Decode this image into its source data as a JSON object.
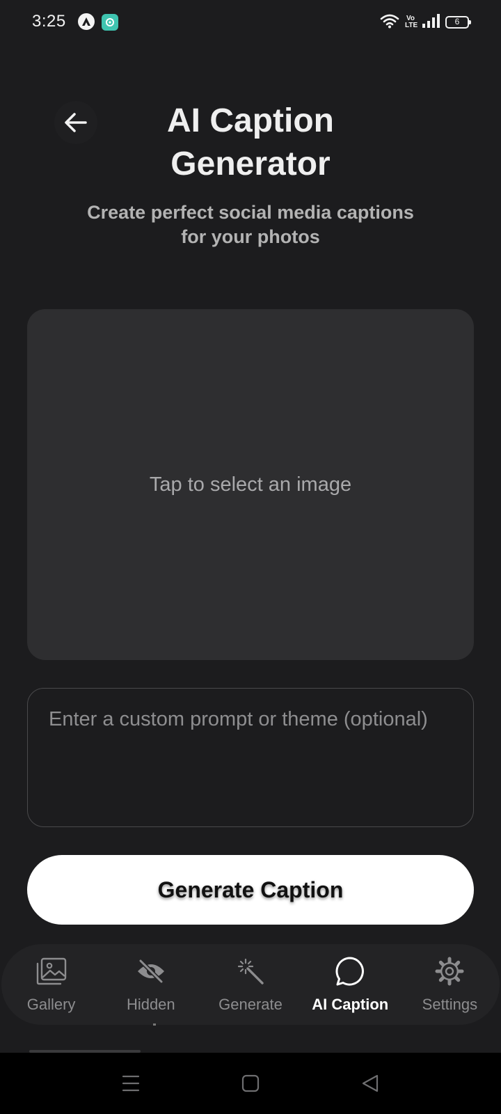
{
  "status_bar": {
    "time": "3:25",
    "volte_label": "Vo LTE",
    "battery_level": "6",
    "icons": [
      "app-a-icon",
      "app-teal-icon",
      "wifi-icon",
      "volte-icon",
      "signal-icon",
      "battery-icon"
    ]
  },
  "header": {
    "back_icon": "arrow-left-icon",
    "title": "AI Caption Generator",
    "subtitle": "Create perfect social media captions for your photos"
  },
  "image_picker": {
    "label": "Tap to select an image"
  },
  "prompt": {
    "placeholder": "Enter a custom prompt or theme (optional)",
    "value": ""
  },
  "generate_button": {
    "label": "Generate Caption"
  },
  "tabs": [
    {
      "label": "Gallery",
      "icon": "image-icon",
      "active": false
    },
    {
      "label": "Hidden",
      "icon": "eye-off-icon",
      "active": false
    },
    {
      "label": "Generate",
      "icon": "magic-wand-icon",
      "active": false
    },
    {
      "label": "AI Caption",
      "icon": "chat-bubble-icon",
      "active": true
    },
    {
      "label": "Settings",
      "icon": "gear-icon",
      "active": false
    }
  ],
  "system_nav": {
    "icons": [
      "menu-icon",
      "home-square-icon",
      "back-triangle-icon"
    ]
  },
  "colors": {
    "background": "#1c1c1e",
    "card": "#2e2e30",
    "button": "#ffffff",
    "tab_bar": "#232325",
    "active_tab": "#ffffff",
    "inactive_tab": "#8d8d8f"
  }
}
